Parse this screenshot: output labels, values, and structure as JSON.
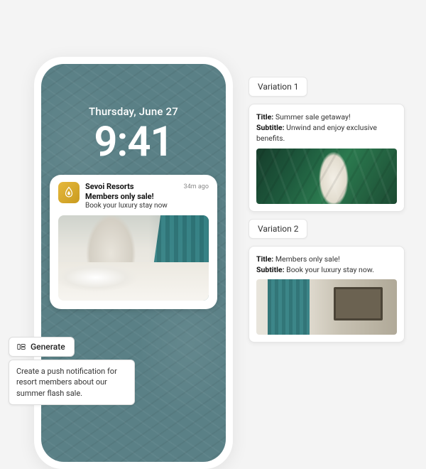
{
  "phone": {
    "date": "Thursday, June 27",
    "time": "9:41"
  },
  "notification": {
    "app_name": "Sevoi Resorts",
    "title": "Members only sale!",
    "subtitle": "Book your luxury stay now",
    "timestamp": "34m ago",
    "app_icon": "flame-drop-icon"
  },
  "generate": {
    "label": "Generate"
  },
  "prompt": {
    "text": "Create a push notification for resort members about our summer flash sale."
  },
  "variations": [
    {
      "tab_label": "Variation 1",
      "title_label": "Title:",
      "title_value": "Summer sale getaway!",
      "subtitle_label": "Subtitle:",
      "subtitle_value": "Unwind and enjoy exclusive benefits.",
      "image": "tropical"
    },
    {
      "tab_label": "Variation 2",
      "title_label": "Title:",
      "title_value": "Members only sale!",
      "subtitle_label": "Subtitle:",
      "subtitle_value": "Book your luxury stay now.",
      "image": "bedroom"
    }
  ]
}
